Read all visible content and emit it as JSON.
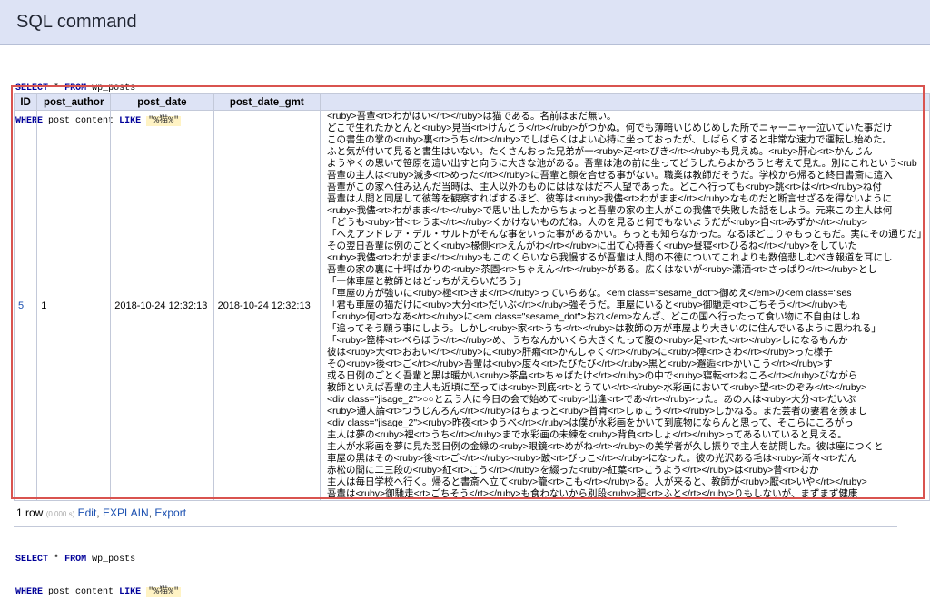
{
  "header": {
    "title": "SQL command"
  },
  "query": {
    "kw_select": "SELECT",
    "star": "*",
    "kw_from": "FROM",
    "table": "wp_posts",
    "kw_where": "WHERE",
    "column": "post_content",
    "kw_like": "LIKE",
    "pattern": "\"%猫%\""
  },
  "results": {
    "columns": [
      "ID",
      "post_author",
      "post_date",
      "post_date_gmt"
    ],
    "row": {
      "id": "5",
      "author": "1",
      "date": "2018-10-24 12:32:13",
      "date_gmt": "2018-10-24 12:32:13",
      "content_lines": [
        "<ruby>吾輩<rt>わがはい</rt></ruby>は猫である。名前はまだ無い。",
        "どこで生れたかとんと<ruby>見当<rt>けんとう</rt></ruby>がつかぬ。何でも薄暗いじめじめした所でニャーニャー泣いていた事だけ",
        "この書生の掌の<ruby>裏<rt>うち</rt></ruby>でしばらくはよい心持に坐っておったが、しばらくすると非常な速力で運転し始めた。",
        "ふと気が付いて見ると書生はいない。たくさんおった兄弟が一<ruby>疋<rt>ぴき</rt></ruby>も見えぬ。<ruby>肝心<rt>かんじん",
        "ようやくの思いで笹原を這い出すと向うに大きな池がある。吾輩は池の前に坐ってどうしたらよかろうと考えて見た。別にこれという<rub",
        "吾輩の主人は<ruby>滅多<rt>めった</rt></ruby>に吾輩と顔を合せる事がない。職業は教師だそうだ。学校から帰ると終日書斎に這入",
        "吾輩がこの家へ住み込んだ当時は、主人以外のものにははなはだ不人望であった。どこへ行っても<ruby>跳<rt>は</rt></ruby>ね付",
        "吾輩は人間と同居して彼等を観察すればするほど、彼等は<ruby>我儘<rt>わがまま</rt></ruby>なものだと断言せざるを得ないように",
        "<ruby>我儘<rt>わがまま</rt></ruby>で思い出したからちょっと吾輩の家の主人がこの我儘で失敗した話をしよう。元来この主人は何",
        "「どうも<ruby>甘<rt>うま</rt></ruby>くかけないものだね。人のを見ると何でもないようだが<ruby>自<rt>みずか</rt></ruby>",
        "「へえアンドレア・デル・サルトがそんな事をいった事があるかい。ちっとも知らなかった。なるほどこりゃもっともだ。実にその通りだ」",
        "その翌日吾輩は例のごとく<ruby>椽側<rt>えんがわ</rt></ruby>に出て心持善く<ruby>昼寝<rt>ひるね</rt></ruby>をしていた",
        "<ruby>我儘<rt>わがまま</rt></ruby>もこのくらいなら我慢するが吾輩は人間の不徳についてこれよりも数倍悲しむべき報道を耳にし",
        "吾輩の家の裏に十坪ばかりの<ruby>茶園<rt>ちゃえん</rt></ruby>がある。広くはないが<ruby>瀟洒<rt>さっぱり</rt></ruby>とし",
        "「一体車屋と教師とはどっちがえらいだろう」",
        "「車屋の方が強いに<ruby>極<rt>きま</rt></ruby>っていらあな。<em class=\"sesame_dot\">御めえ</em>の<em class=\"ses",
        "「君も車屋の猫だけに<ruby>大分<rt>だいぶ</rt></ruby>強そうだ。車屋にいると<ruby>御馳走<rt>ごちそう</rt></ruby>も",
        "「<ruby>何<rt>なあ</rt></ruby>に<em class=\"sesame_dot\">おれ</em>なんざ、どこの国へ行ったって食い物に不自由はしね",
        "「追ってそう願う事にしよう。しかし<ruby>家<rt>うち</rt></ruby>は教師の方が車屋より大きいのに住んでいるように思われる」",
        "「<ruby>箆棒<rt>べらぼう</rt></ruby>め、うちなんかいくら大きくたって腹の<ruby>足<rt>た</rt></ruby>しになるもんか",
        "彼は<ruby>大<rt>おおい</rt></ruby>に<ruby>肝癪<rt>かんしゃく</rt></ruby>に<ruby>障<rt>さわ</rt></ruby>った様子",
        "その<ruby>後<rt>ご</rt></ruby>吾輩は<ruby>度々<rt>たびたび</rt></ruby>黒と<ruby>邂逅<rt>かいこう</rt></ruby>す",
        "或る日例のごとく吾輩と黒は暖かい<ruby>茶畠<rt>ちゃばたけ</rt></ruby>の中で<ruby>寝転<rt>ねころ</rt></ruby>びながら",
        "教師といえば吾輩の主人も近頃に至っては<ruby>到底<rt>とうてい</rt></ruby>水彩画において<ruby>望<rt>のぞみ</rt></ruby>",
        "<div class=\"jisage_2\">○○と云う人に今日の会で始めて<ruby>出逢<rt>であ</rt></ruby>った。あの人は<ruby>大分<rt>だいぶ",
        "<ruby>通人論<rt>つうじんろん</rt></ruby>はちょっと<ruby>首肯<rt>しゅこう</rt></ruby>しかねる。また芸者の妻君を羨まし",
        "<div class=\"jisage_2\"><ruby>昨夜<rt>ゆうべ</rt></ruby>は僕が水彩画をかいて到底物にならんと思って、そこらにころがっ",
        "主人は夢の<ruby>裡<rt>うち</rt></ruby>まで水彩画の未練を<ruby>背負<rt>しょ</rt></ruby>ってあるいていると見える。",
        "主人が水彩画を夢に見た翌日例の金縁の<ruby>眼鏡<rt>めがね</rt></ruby>の美学者が久し振りで主人を訪問した。彼は座につくと",
        "車屋の黒はその<ruby>後<rt>ご</rt></ruby><ruby>跛<rt>びっこ</rt></ruby>になった。彼の光沢ある毛は<ruby>漸々<rt>だん",
        "赤松の間に二三段の<ruby>紅<rt>こう</rt></ruby>を綴った<ruby>紅葉<rt>こうよう</rt></ruby>は<ruby>昔<rt>むか",
        "主人は毎日学校へ行く。帰ると書斎へ立て<ruby>籠<rt>こも</rt></ruby>る。人が来ると、教師が<ruby>厭<rt>いや</rt></ruby>",
        "吾輩は<ruby>御馳走<rt>ごちそう</rt></ruby>も食わないから別段<ruby>肥<rt>ふと</rt></ruby>りもしないが、まずまず健康"
      ]
    }
  },
  "footer": {
    "row_count": "1 row",
    "timing": "(0.000 s)",
    "link_edit": "Edit",
    "sep": ",",
    "link_explain": "EXPLAIN",
    "link_export": "Export"
  }
}
